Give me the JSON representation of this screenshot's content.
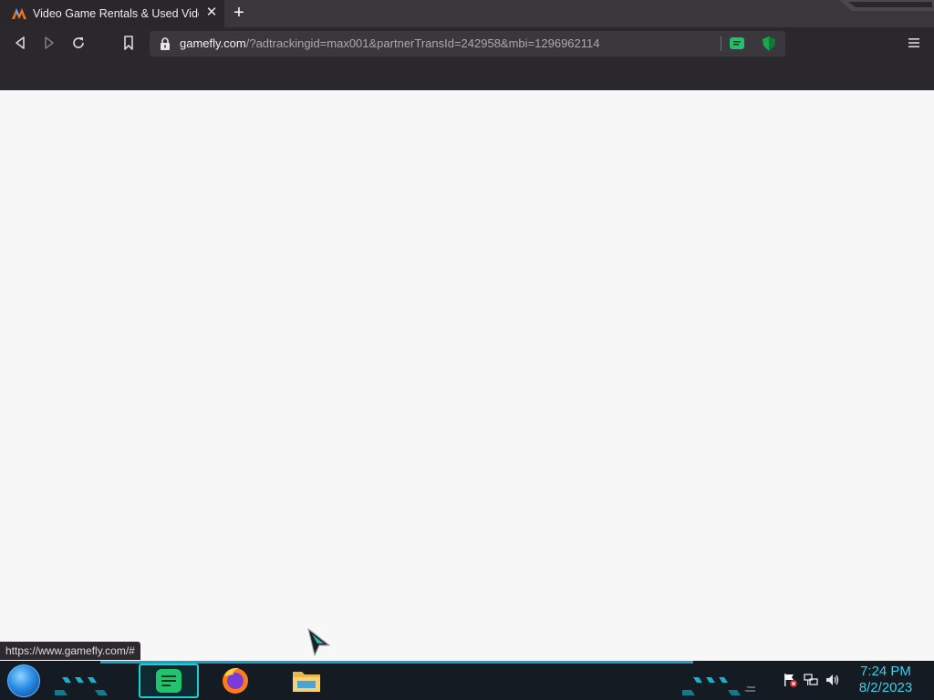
{
  "browser": {
    "tab": {
      "title": "Video Game Rentals & Used Video Games",
      "favicon": "gamefly-logo-icon"
    },
    "new_tab_label": "+",
    "address_bar": {
      "host": "gamefly.com",
      "path": "/?adtrackingid=max001&partnerTransId=242958&mbi=1296962114"
    },
    "status_bar_text": "https://www.gamefly.com/#"
  },
  "taskbar": {
    "apps": [
      {
        "name": "sticky-notes",
        "active": true
      },
      {
        "name": "firefox",
        "active": false
      },
      {
        "name": "file-explorer",
        "active": false
      }
    ],
    "clock": {
      "time": "7:24 PM",
      "date": "8/2/2023"
    }
  },
  "colors": {
    "toolbar": "#2a282c",
    "tabstrip": "#39373c",
    "page_background": "#f7f7f8",
    "taskbar": "#151b22",
    "taskbar_accent": "#1aa0c6",
    "clock": "#3ad0e8"
  }
}
